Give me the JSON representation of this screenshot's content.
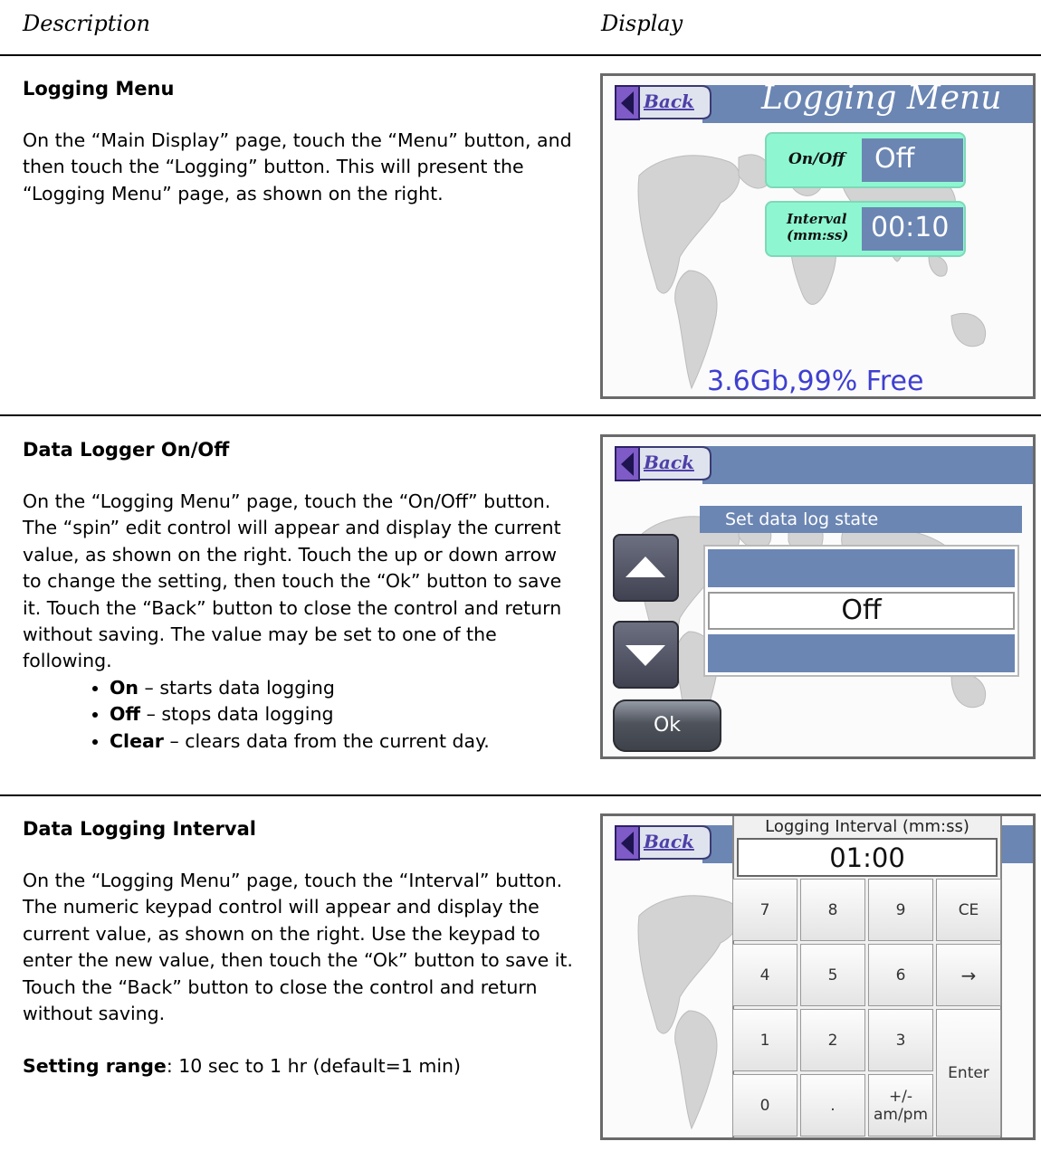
{
  "headers": {
    "description": "Description",
    "display": "Display"
  },
  "sections": [
    {
      "title": "Logging Menu",
      "paragraph": "On the “Main Display” page, touch the “Menu” button, and then touch the “Logging” button. This will present the “Logging Menu” page, as shown on the right."
    },
    {
      "title": "Data Logger On/Off",
      "paragraph": "On the “Logging Menu” page, touch the “On/Off” button.  The “spin” edit control will appear and display the current value, as shown on the right. Touch the up or down arrow to change the setting, then touch the “Ok” button to save it. Touch the “Back” button to close the control and return without saving.  The value may be set to one of the following.",
      "options": [
        {
          "term": "On",
          "text": " – starts data logging"
        },
        {
          "term": "Off",
          "text": " – stops data logging"
        },
        {
          "term": "Clear",
          "text": " – clears data from the current day."
        }
      ]
    },
    {
      "title": "Data Logging Interval",
      "paragraph": "On the “Logging Menu” page, touch the “Interval” button.  The numeric keypad control will appear and display the current value, as shown on the right.  Use the keypad to enter the new value, then touch the “Ok” button to save it.  Touch the “Back” button to close the control and return without saving.",
      "range_label": "Setting range",
      "range_value": ": 10 sec to 1 hr  (default=1 min)"
    }
  ],
  "screen1": {
    "back": "Back",
    "title": "Logging Menu",
    "onoff_caption": "On/Off",
    "onoff_value": "Off",
    "interval_caption_1": "Interval",
    "interval_caption_2": "(mm:ss)",
    "interval_value": "00:10",
    "storage": "3.6Gb,99% Free"
  },
  "screen2": {
    "back": "Back",
    "prompt": "Set data log state",
    "value": "Off",
    "ok": "Ok"
  },
  "screen3": {
    "back": "Back",
    "title": "Logging Interval (mm:ss)",
    "value": "01:00",
    "keys": {
      "k7": "7",
      "k8": "8",
      "k9": "9",
      "ce": "CE",
      "k4": "4",
      "k5": "5",
      "k6": "6",
      "arrow": "→",
      "k1": "1",
      "k2": "2",
      "k3": "3",
      "enter": "Enter",
      "k0": "0",
      "dot": ".",
      "pm1": "+/-",
      "pm2": "am/pm"
    }
  },
  "colors": {
    "bar": "#6b86b3",
    "teal": "#8ef7d2",
    "back_label": "#4e3fa8",
    "storage_text": "#3f3fd0"
  },
  "icons": [
    "back-arrow-icon",
    "up-arrow-icon",
    "down-arrow-icon",
    "world-map-background"
  ]
}
